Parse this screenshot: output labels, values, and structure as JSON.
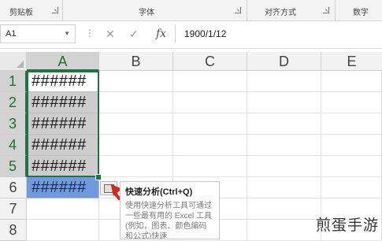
{
  "ribbon": {
    "groups": [
      {
        "label": "剪贴板"
      },
      {
        "label": "字体"
      },
      {
        "label": "对齐方式"
      },
      {
        "label": "数字"
      }
    ]
  },
  "formula_bar": {
    "name_box": "A1",
    "cancel_symbol": "✕",
    "enter_symbol": "✓",
    "fx_symbol": "fx",
    "content": "1900/1/12"
  },
  "sheet": {
    "columns": [
      "A",
      "B",
      "C",
      "D",
      "E"
    ],
    "rows": [
      "1",
      "2",
      "3",
      "4",
      "5",
      "6",
      "7",
      "8"
    ],
    "column_a_values": [
      "######",
      "######",
      "######",
      "######",
      "######",
      "######"
    ],
    "selection_color": "#217346",
    "highlight_color": "#6f9bdc"
  },
  "quick_analysis": {
    "title": "快速分析(Ctrl+Q)",
    "description": "使用快速分析工具可通过一些最有用的 Excel 工具(例如，图表、颜色编码和公式)快速"
  },
  "watermark": "煎蛋手游"
}
